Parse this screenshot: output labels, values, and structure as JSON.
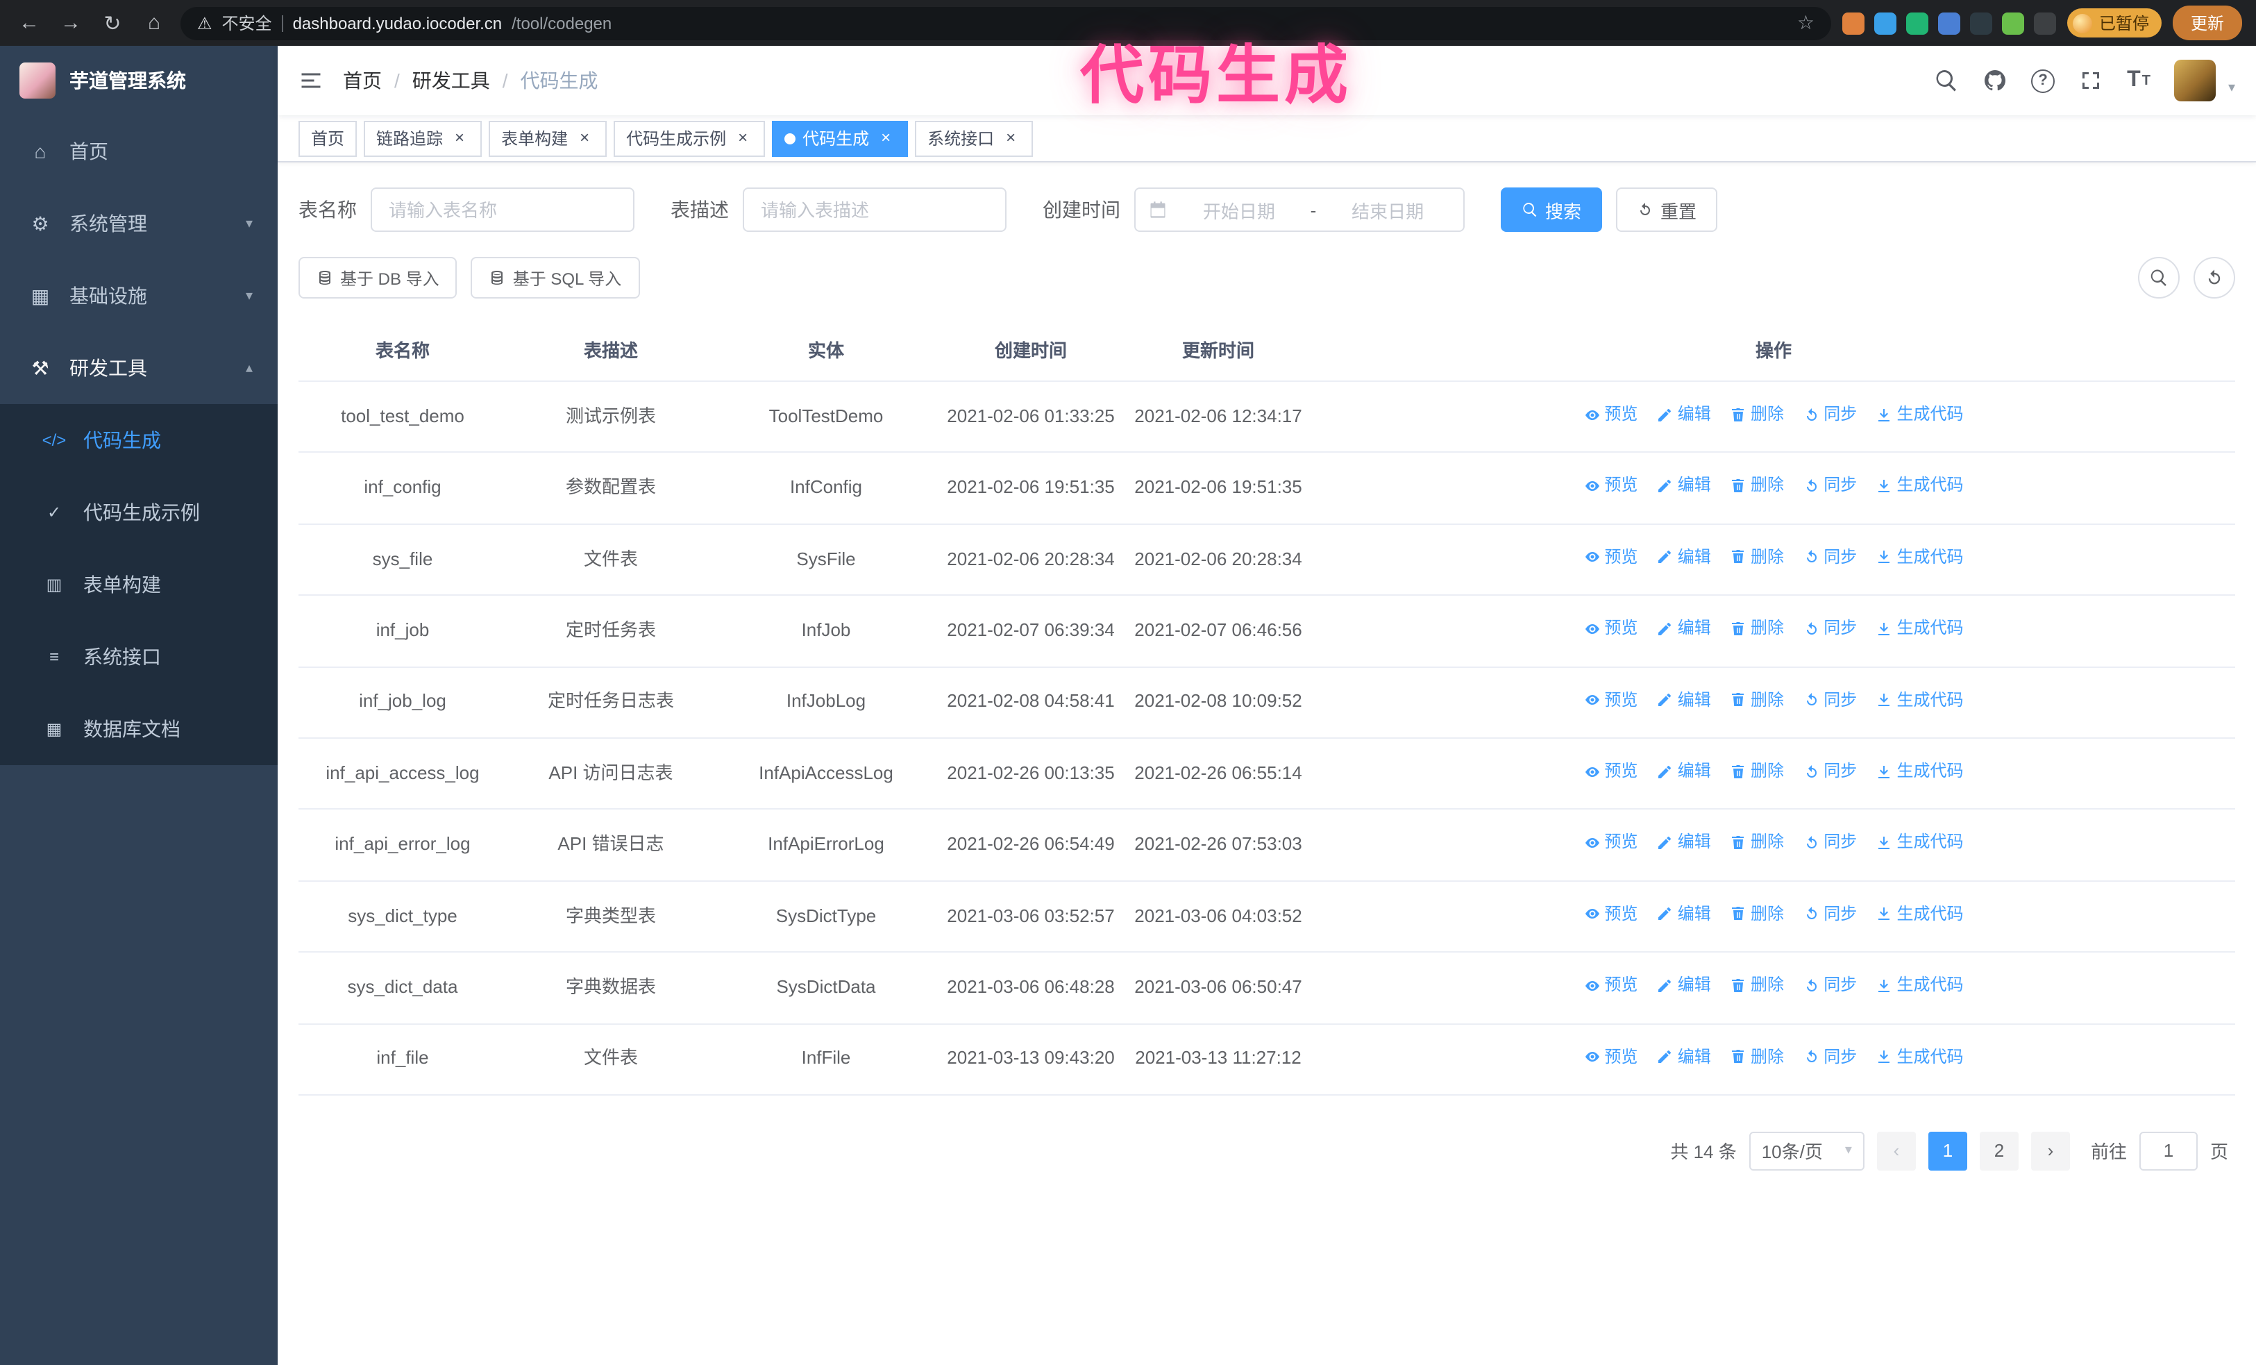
{
  "theme": {
    "accent": "#409eff",
    "pink": "#ff4796",
    "sidebar_bg": "#304156",
    "submenu_bg": "#1f2d3d",
    "sidebar_text": "#bfcbd9",
    "chrome_bg": "#202225",
    "update_orange": "#c97a33"
  },
  "icons": {
    "back": "←",
    "forward": "→",
    "reload": "↻",
    "home": "⌂",
    "warning": "⚠",
    "star": "☆",
    "close": "×",
    "prev": "‹",
    "next": "›",
    "caret_down": "▾",
    "help": "?",
    "text_size": "T"
  },
  "browser": {
    "security_label": "不安全",
    "url_host": "dashboard.yudao.iocoder.cn",
    "url_path": "/tool/codegen",
    "paused_badge": "已暂停",
    "update_label": "更新",
    "extensions": [
      {
        "name": "extension-shield",
        "color": "#e0813d"
      },
      {
        "name": "extension-drop",
        "color": "#3aa0e8"
      },
      {
        "name": "extension-check",
        "color": "#21b573"
      },
      {
        "name": "extension-people",
        "color": "#4a7fd4"
      },
      {
        "name": "extension-terminal",
        "color": "#2d3a42"
      },
      {
        "name": "extension-leaf",
        "color": "#6abf4b"
      },
      {
        "name": "extension-paw",
        "color": "#3d4043"
      }
    ]
  },
  "annotation": {
    "text": "代码生成"
  },
  "sidebar": {
    "logo_title": "芋道管理系统",
    "items": [
      {
        "label": "首页",
        "glyph": "⌂",
        "icon": "home-icon"
      },
      {
        "label": "系统管理",
        "glyph": "⚙",
        "icon": "gear-icon",
        "arrow": "▾"
      },
      {
        "label": "基础设施",
        "glyph": "▦",
        "icon": "infrastructure-icon",
        "arrow": "▾"
      },
      {
        "label": "研发工具",
        "glyph": "⚒",
        "icon": "dev-tools-icon",
        "arrow": "▴",
        "expanded": true
      }
    ],
    "submenu": [
      {
        "label": "代码生成",
        "glyph": "</>",
        "icon": "code-generation-icon",
        "active": true
      },
      {
        "label": "代码生成示例",
        "glyph": "✓",
        "icon": "code-example-icon"
      },
      {
        "label": "表单构建",
        "glyph": "▥",
        "icon": "form-builder-icon"
      },
      {
        "label": "系统接口",
        "glyph": "≡",
        "icon": "system-api-icon"
      },
      {
        "label": "数据库文档",
        "glyph": "▦",
        "icon": "db-doc-icon"
      }
    ]
  },
  "header": {
    "separator": "/",
    "breadcrumb": [
      {
        "label": "首页"
      },
      {
        "label": "研发工具"
      },
      {
        "label": "代码生成",
        "current": true
      }
    ]
  },
  "tabs": [
    {
      "label": "首页"
    },
    {
      "label": "链路追踪",
      "closable": true
    },
    {
      "label": "表单构建",
      "closable": true
    },
    {
      "label": "代码生成示例",
      "closable": true
    },
    {
      "label": "代码生成",
      "closable": true,
      "active": true
    },
    {
      "label": "系统接口",
      "closable": true
    }
  ],
  "filters": {
    "table_name_label": "表名称",
    "table_name_placeholder": "请输入表名称",
    "table_desc_label": "表描述",
    "table_desc_placeholder": "请输入表描述",
    "create_time_label": "创建时间",
    "date_start_placeholder": "开始日期",
    "date_separator": "-",
    "date_end_placeholder": "结束日期",
    "search_label": "搜索",
    "reset_label": "重置"
  },
  "toolbar": {
    "import_db_label": "基于 DB 导入",
    "import_sql_label": "基于 SQL 导入"
  },
  "table": {
    "columns": [
      "表名称",
      "表描述",
      "实体",
      "创建时间",
      "更新时间",
      "操作"
    ],
    "action_labels": {
      "preview": "预览",
      "edit": "编辑",
      "delete": "删除",
      "sync": "同步",
      "generate": "生成代码"
    },
    "rows": [
      {
        "name": "tool_test_demo",
        "desc": "测试示例表",
        "entity": "ToolTestDemo",
        "created": "2021-02-06 01:33:25",
        "updated": "2021-02-06 12:34:17"
      },
      {
        "name": "inf_config",
        "desc": "参数配置表",
        "entity": "InfConfig",
        "created": "2021-02-06 19:51:35",
        "updated": "2021-02-06 19:51:35"
      },
      {
        "name": "sys_file",
        "desc": "文件表",
        "entity": "SysFile",
        "created": "2021-02-06 20:28:34",
        "updated": "2021-02-06 20:28:34"
      },
      {
        "name": "inf_job",
        "desc": "定时任务表",
        "entity": "InfJob",
        "created": "2021-02-07 06:39:34",
        "updated": "2021-02-07 06:46:56"
      },
      {
        "name": "inf_job_log",
        "desc": "定时任务日志表",
        "entity": "InfJobLog",
        "created": "2021-02-08 04:58:41",
        "updated": "2021-02-08 10:09:52"
      },
      {
        "name": "inf_api_access_log",
        "desc": "API 访问日志表",
        "entity": "InfApiAccessLog",
        "created": "2021-02-26 00:13:35",
        "updated": "2021-02-26 06:55:14"
      },
      {
        "name": "inf_api_error_log",
        "desc": "API 错误日志",
        "entity": "InfApiErrorLog",
        "created": "2021-02-26 06:54:49",
        "updated": "2021-02-26 07:53:03"
      },
      {
        "name": "sys_dict_type",
        "desc": "字典类型表",
        "entity": "SysDictType",
        "created": "2021-03-06 03:52:57",
        "updated": "2021-03-06 04:03:52"
      },
      {
        "name": "sys_dict_data",
        "desc": "字典数据表",
        "entity": "SysDictData",
        "created": "2021-03-06 06:48:28",
        "updated": "2021-03-06 06:50:47"
      },
      {
        "name": "inf_file",
        "desc": "文件表",
        "entity": "InfFile",
        "created": "2021-03-13 09:43:20",
        "updated": "2021-03-13 11:27:12"
      }
    ]
  },
  "pagination": {
    "total_text": "共 14 条",
    "page_size_text": "10条/页",
    "pages": [
      {
        "label": "1",
        "active": true
      },
      {
        "label": "2"
      }
    ],
    "goto_label": "前往",
    "goto_value": "1",
    "unit_label": "页"
  }
}
